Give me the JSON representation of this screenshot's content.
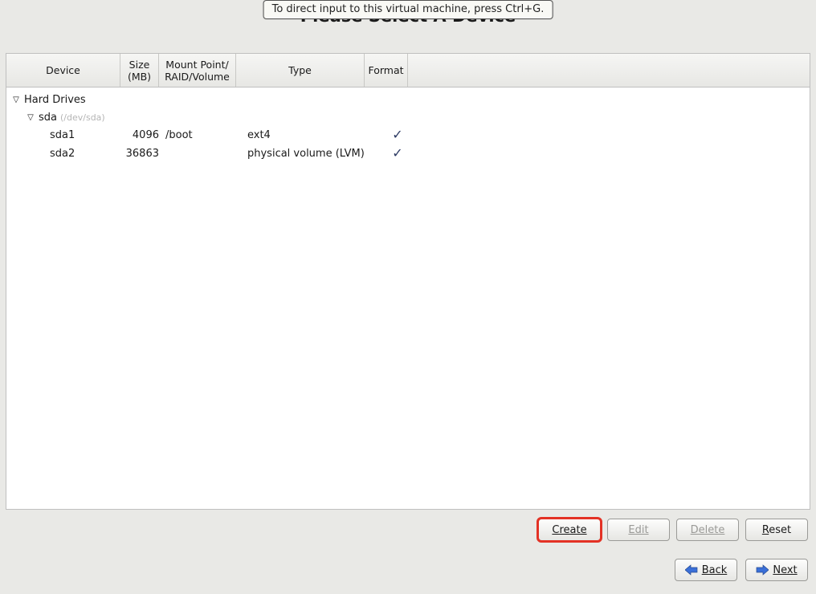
{
  "vm_hint": "To direct input to this virtual machine, press Ctrl+G.",
  "title": "Please Select A Device",
  "columns": {
    "device": "Device",
    "size": "Size\n(MB)",
    "mount": "Mount Point/\nRAID/Volume",
    "type": "Type",
    "format": "Format"
  },
  "tree": {
    "root_label": "Hard Drives",
    "disk": {
      "name": "sda",
      "path": "(/dev/sda)"
    },
    "partitions": [
      {
        "name": "sda1",
        "size": "4096",
        "mount": "/boot",
        "type": "ext4",
        "format": true
      },
      {
        "name": "sda2",
        "size": "36863",
        "mount": "",
        "type": "physical volume (LVM)",
        "format": true
      }
    ]
  },
  "buttons": {
    "create": "Create",
    "edit": "Edit",
    "delete": "Delete",
    "reset": "Reset",
    "back": "Back",
    "next": "Next"
  }
}
